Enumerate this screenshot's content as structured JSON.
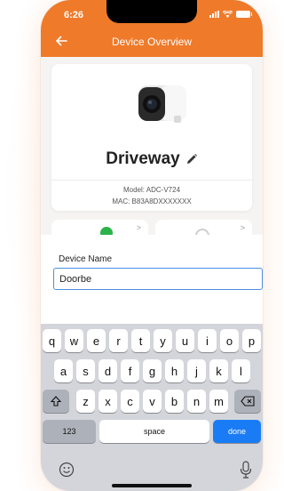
{
  "status_bar": {
    "time": "6:26"
  },
  "nav": {
    "title": "Device Overview"
  },
  "device": {
    "name": "Driveway",
    "model": "Model: ADC-V724",
    "mac": "MAC: B83A8DXXXXXXX"
  },
  "tiles": {
    "chevron": ">"
  },
  "edit": {
    "label": "Device Name",
    "value": "Doorbe"
  },
  "keyboard": {
    "row1": [
      "q",
      "w",
      "e",
      "r",
      "t",
      "y",
      "u",
      "i",
      "o",
      "p"
    ],
    "row2": [
      "a",
      "s",
      "d",
      "f",
      "g",
      "h",
      "j",
      "k",
      "l"
    ],
    "row3": [
      "z",
      "x",
      "c",
      "v",
      "b",
      "n",
      "m"
    ],
    "numbers_label": "123",
    "space_label": "space",
    "done_label": "done"
  },
  "colors": {
    "accent": "#ef7a2a",
    "success": "#2bb24c",
    "done_key": "#1a7cf5"
  },
  "icons": [
    "back-arrow-icon",
    "pencil-icon",
    "check-icon",
    "shift-icon",
    "backspace-icon",
    "emoji-icon",
    "mic-icon"
  ]
}
